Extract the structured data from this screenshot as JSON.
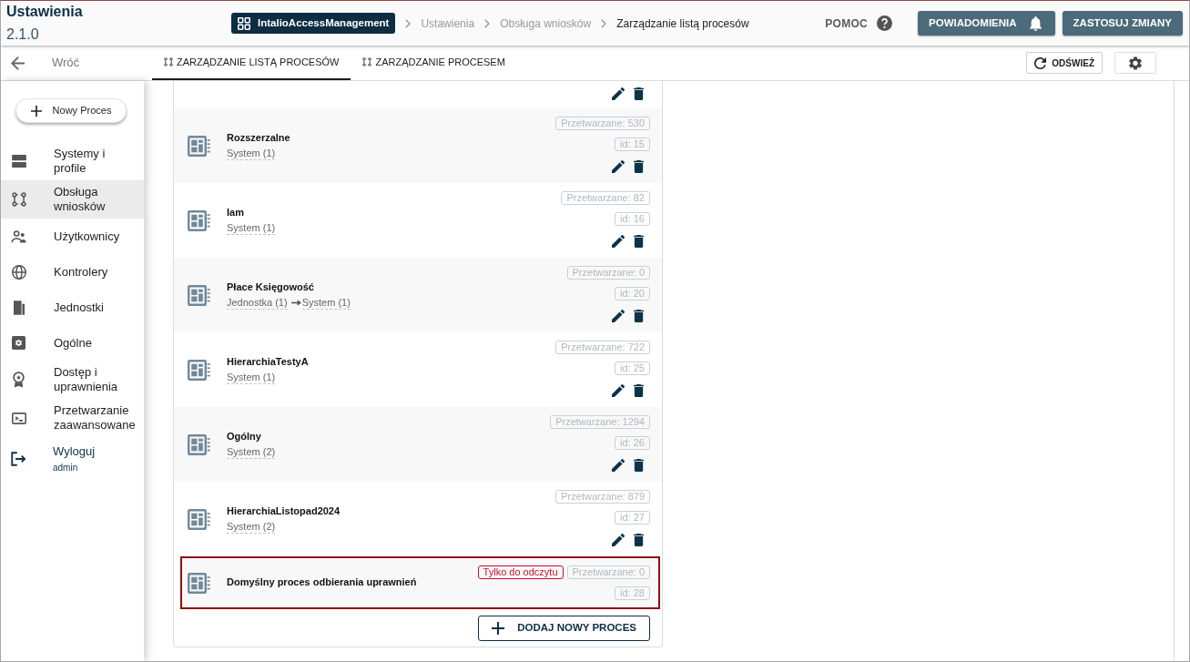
{
  "header": {
    "title": "Ustawienia",
    "version": "2.1.0",
    "breadcrumb": [
      {
        "label": "IntalioAccessManagement",
        "kind": "app"
      },
      {
        "label": "Ustawienia",
        "kind": "link"
      },
      {
        "label": "Obsługa wniosków",
        "kind": "link"
      },
      {
        "label": "Zarządzanie listą procesów",
        "kind": "current"
      }
    ],
    "help": "POMOC",
    "buttons": [
      {
        "label": "POWIADOMIENIA",
        "kind": "notifications"
      },
      {
        "label": "ZASTOSUJ ZMIANY",
        "kind": "apply"
      }
    ]
  },
  "toolbar": {
    "back": "Wróć",
    "tabs": [
      {
        "label": "ZARZĄDZANIE LISTĄ PROCESÓW",
        "selected": true
      },
      {
        "label": "ZARZĄDZANIE PROCESEM",
        "selected": false
      }
    ],
    "refresh": "ODŚWIEŻ"
  },
  "sidebar": {
    "new_button": "Nowy Proces",
    "items": [
      {
        "label": "Systemy i profile",
        "kind": "link",
        "selected": false
      },
      {
        "label": "Obsługa wniosków",
        "kind": "link",
        "selected": true
      },
      {
        "label": "Użytkownicy",
        "kind": "link",
        "selected": false
      },
      {
        "label": "Kontrolery",
        "kind": "link",
        "selected": false
      },
      {
        "label": "Jednostki",
        "kind": "link",
        "selected": false
      },
      {
        "label": "Ogólne",
        "kind": "link",
        "selected": false
      },
      {
        "label": "Dostęp i uprawnienia",
        "kind": "link",
        "selected": false
      },
      {
        "label": "Przetwarzanie zaawansowane",
        "kind": "link",
        "selected": false
      },
      {
        "label": "Wyloguj",
        "sublabel": "admin",
        "kind": "logout",
        "selected": false
      }
    ]
  },
  "processes": {
    "rows": [
      {
        "kind": "clipped",
        "editable": true,
        "highlighted": false
      },
      {
        "kind": "process",
        "name": "Rozszerzalne",
        "path": [
          "System (1)"
        ],
        "processed": "Przetwarzane: 530",
        "id": "id: 15",
        "editable": true,
        "highlighted": false
      },
      {
        "kind": "process",
        "name": "Iam",
        "path": [
          "System (1)"
        ],
        "processed": "Przetwarzane: 82",
        "id": "id: 16",
        "editable": true,
        "highlighted": false
      },
      {
        "kind": "process",
        "name": "Płace Księgowość",
        "path": [
          "Jednostka (1)",
          "System (1)"
        ],
        "processed": "Przetwarzane: 0",
        "id": "id: 20",
        "editable": true,
        "highlighted": false
      },
      {
        "kind": "process",
        "name": "HierarchiaTestyA",
        "path": [
          "System (1)"
        ],
        "processed": "Przetwarzane: 722",
        "id": "id: 25",
        "editable": true,
        "highlighted": false
      },
      {
        "kind": "process",
        "name": "Ogólny",
        "path": [
          "System (2)"
        ],
        "processed": "Przetwarzane: 1294",
        "id": "id: 26",
        "editable": true,
        "highlighted": false
      },
      {
        "kind": "process",
        "name": "HierarchiaListopad2024",
        "path": [
          "System (2)"
        ],
        "processed": "Przetwarzane: 879",
        "id": "id: 27",
        "editable": true,
        "highlighted": false
      },
      {
        "kind": "process",
        "name": "Domyślny proces odbierania uprawnień",
        "flag": "Tylko do odczytu",
        "processed": "Przetwarzane: 0",
        "id": "id: 28",
        "editable": false,
        "highlighted": true
      }
    ],
    "add_button": "DODAJ NOWY PROCES"
  }
}
